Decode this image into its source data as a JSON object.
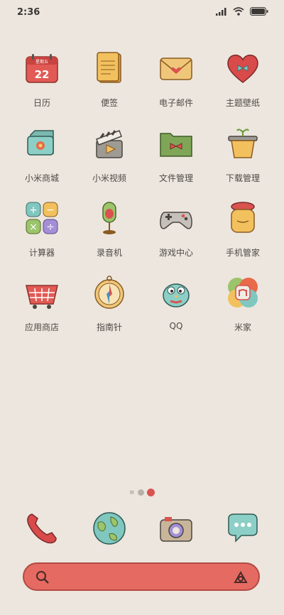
{
  "status": {
    "time": "2:36"
  },
  "apps": [
    {
      "label": "日历",
      "icon": "calendar-icon",
      "cal_top": "星期五",
      "cal_day": "22"
    },
    {
      "label": "便签",
      "icon": "notes-icon"
    },
    {
      "label": "电子邮件",
      "icon": "email-icon"
    },
    {
      "label": "主题壁纸",
      "icon": "theme-heart-icon"
    },
    {
      "label": "小米商城",
      "icon": "mi-store-icon"
    },
    {
      "label": "小米视频",
      "icon": "video-clapper-icon"
    },
    {
      "label": "文件管理",
      "icon": "file-folder-icon"
    },
    {
      "label": "下载管理",
      "icon": "download-pot-icon"
    },
    {
      "label": "计算器",
      "icon": "calculator-icon"
    },
    {
      "label": "录音机",
      "icon": "microphone-icon"
    },
    {
      "label": "游戏中心",
      "icon": "gamepad-icon"
    },
    {
      "label": "手机管家",
      "icon": "security-jar-icon"
    },
    {
      "label": "应用商店",
      "icon": "shopping-basket-icon"
    },
    {
      "label": "指南针",
      "icon": "compass-icon"
    },
    {
      "label": "QQ",
      "icon": "qq-bird-icon"
    },
    {
      "label": "米家",
      "icon": "mijia-flower-icon"
    }
  ],
  "dock": [
    "phone-icon",
    "globe-icon",
    "camera-icon",
    "message-icon"
  ],
  "colors": {
    "background": "#ece6de",
    "search_bar": "#e56a62",
    "accent_red": "#d9534f"
  }
}
